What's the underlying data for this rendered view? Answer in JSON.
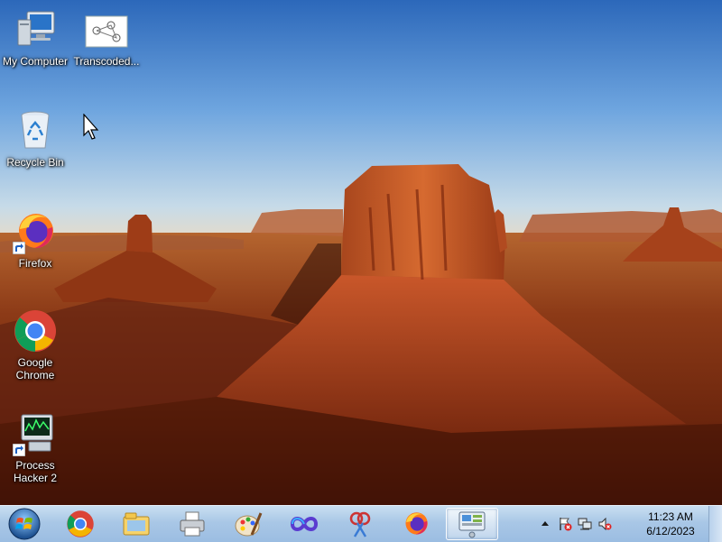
{
  "desktop": {
    "icons": [
      {
        "label": "My Computer",
        "icon": "computer-icon"
      },
      {
        "label": "Transcoded...",
        "icon": "image-thumbnail-icon"
      },
      {
        "label": "Recycle Bin",
        "icon": "recycle-bin-icon"
      },
      {
        "label": "Firefox",
        "icon": "firefox-icon"
      },
      {
        "label": "Google Chrome",
        "icon": "chrome-icon"
      },
      {
        "label": "Process Hacker 2",
        "icon": "process-hacker-icon"
      }
    ]
  },
  "taskbar": {
    "start": {
      "icon": "windows-orb-icon"
    },
    "pinned": [
      {
        "icon": "chrome-icon"
      },
      {
        "icon": "file-explorer-icon"
      },
      {
        "icon": "printer-icon"
      },
      {
        "icon": "paint-icon"
      },
      {
        "icon": "infinity-app-icon"
      },
      {
        "icon": "snipping-tool-icon"
      },
      {
        "icon": "firefox-icon"
      },
      {
        "icon": "control-panel-icon",
        "active": true
      }
    ],
    "tray": {
      "icons": [
        "show-hidden-icons-arrow",
        "action-center-flag-icon",
        "network-icon",
        "volume-muted-icon"
      ],
      "time": "11:23 AM",
      "date": "6/12/2023"
    }
  },
  "colors": {
    "sky_top": "#2f6fc0",
    "rock": "#b2441c",
    "taskbar": "#a9c7e6"
  }
}
